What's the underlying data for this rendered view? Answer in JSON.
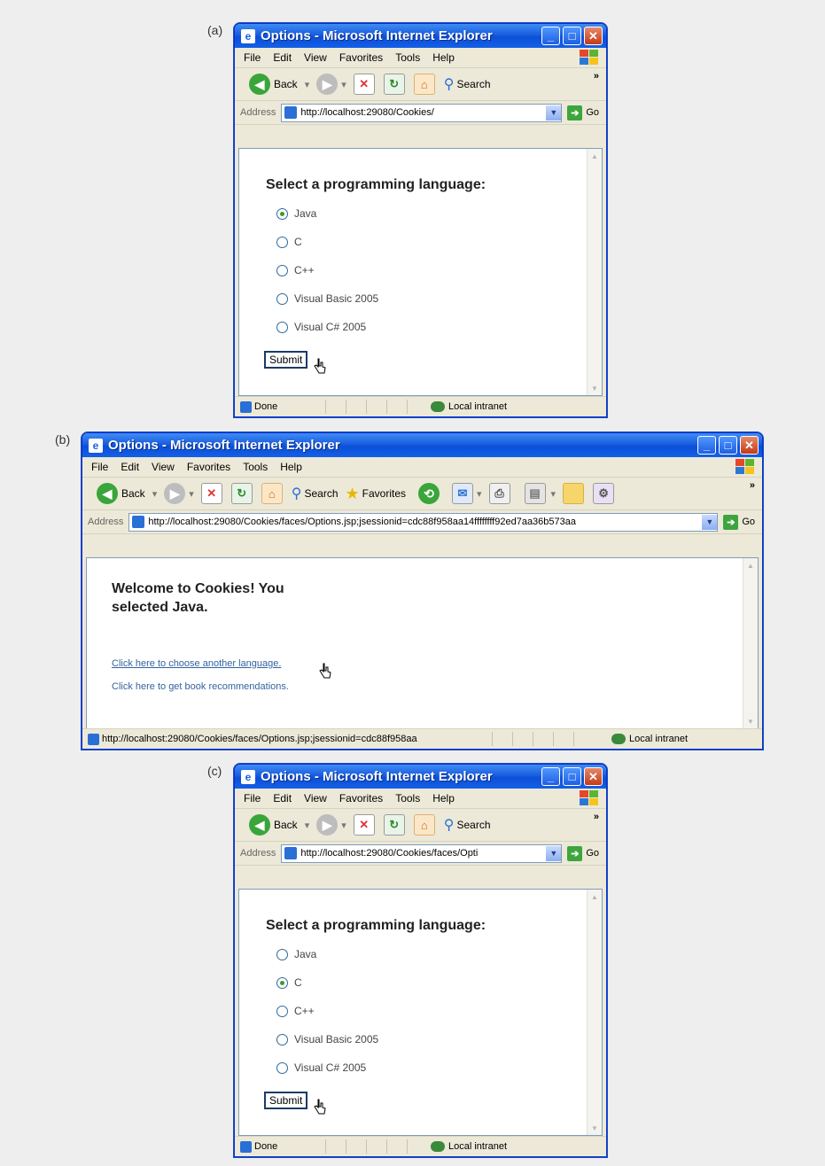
{
  "panels": [
    {
      "label": "(a)",
      "title": "Options - Microsoft Internet Explorer",
      "menu": [
        "File",
        "Edit",
        "View",
        "Favorites",
        "Tools",
        "Help"
      ],
      "toolbar": {
        "back": "Back",
        "search": "Search"
      },
      "address_label": "Address",
      "address_value": "http://localhost:29080/Cookies/",
      "go": "Go",
      "page": {
        "heading": "Select a programming language:",
        "options": [
          "Java",
          "C",
          "C++",
          "Visual Basic 2005",
          "Visual C# 2005"
        ],
        "selected_index": 0,
        "submit": "Submit"
      },
      "status": "Done",
      "zone": "Local intranet"
    },
    {
      "label": "(b)",
      "title": "Options - Microsoft Internet Explorer",
      "menu": [
        "File",
        "Edit",
        "View",
        "Favorites",
        "Tools",
        "Help"
      ],
      "toolbar": {
        "back": "Back",
        "search": "Search",
        "favorites": "Favorites"
      },
      "address_label": "Address",
      "address_value": "http://localhost:29080/Cookies/faces/Options.jsp;jsessionid=cdc88f958aa14ffffffff92ed7aa36b573aa",
      "go": "Go",
      "page": {
        "heading_line1": "Welcome to Cookies! You",
        "heading_line2": "selected Java.",
        "link1": "Click here to choose another language.",
        "link2": "Click here to get book recommendations."
      },
      "status": "http://localhost:29080/Cookies/faces/Options.jsp;jsessionid=cdc88f958aa",
      "zone": "Local intranet"
    },
    {
      "label": "(c)",
      "title": "Options - Microsoft Internet Explorer",
      "menu": [
        "File",
        "Edit",
        "View",
        "Favorites",
        "Tools",
        "Help"
      ],
      "toolbar": {
        "back": "Back",
        "search": "Search"
      },
      "address_label": "Address",
      "address_value": "http://localhost:29080/Cookies/faces/Opti",
      "go": "Go",
      "page": {
        "heading": "Select a programming language:",
        "options": [
          "Java",
          "C",
          "C++",
          "Visual Basic 2005",
          "Visual C# 2005"
        ],
        "selected_index": 1,
        "submit": "Submit"
      },
      "status": "Done",
      "zone": "Local intranet"
    }
  ],
  "colors": {
    "title_bar": "#1a5ee0",
    "chrome": "#ece9d8",
    "link": "#3363a0",
    "close_button": "#c33a17"
  }
}
